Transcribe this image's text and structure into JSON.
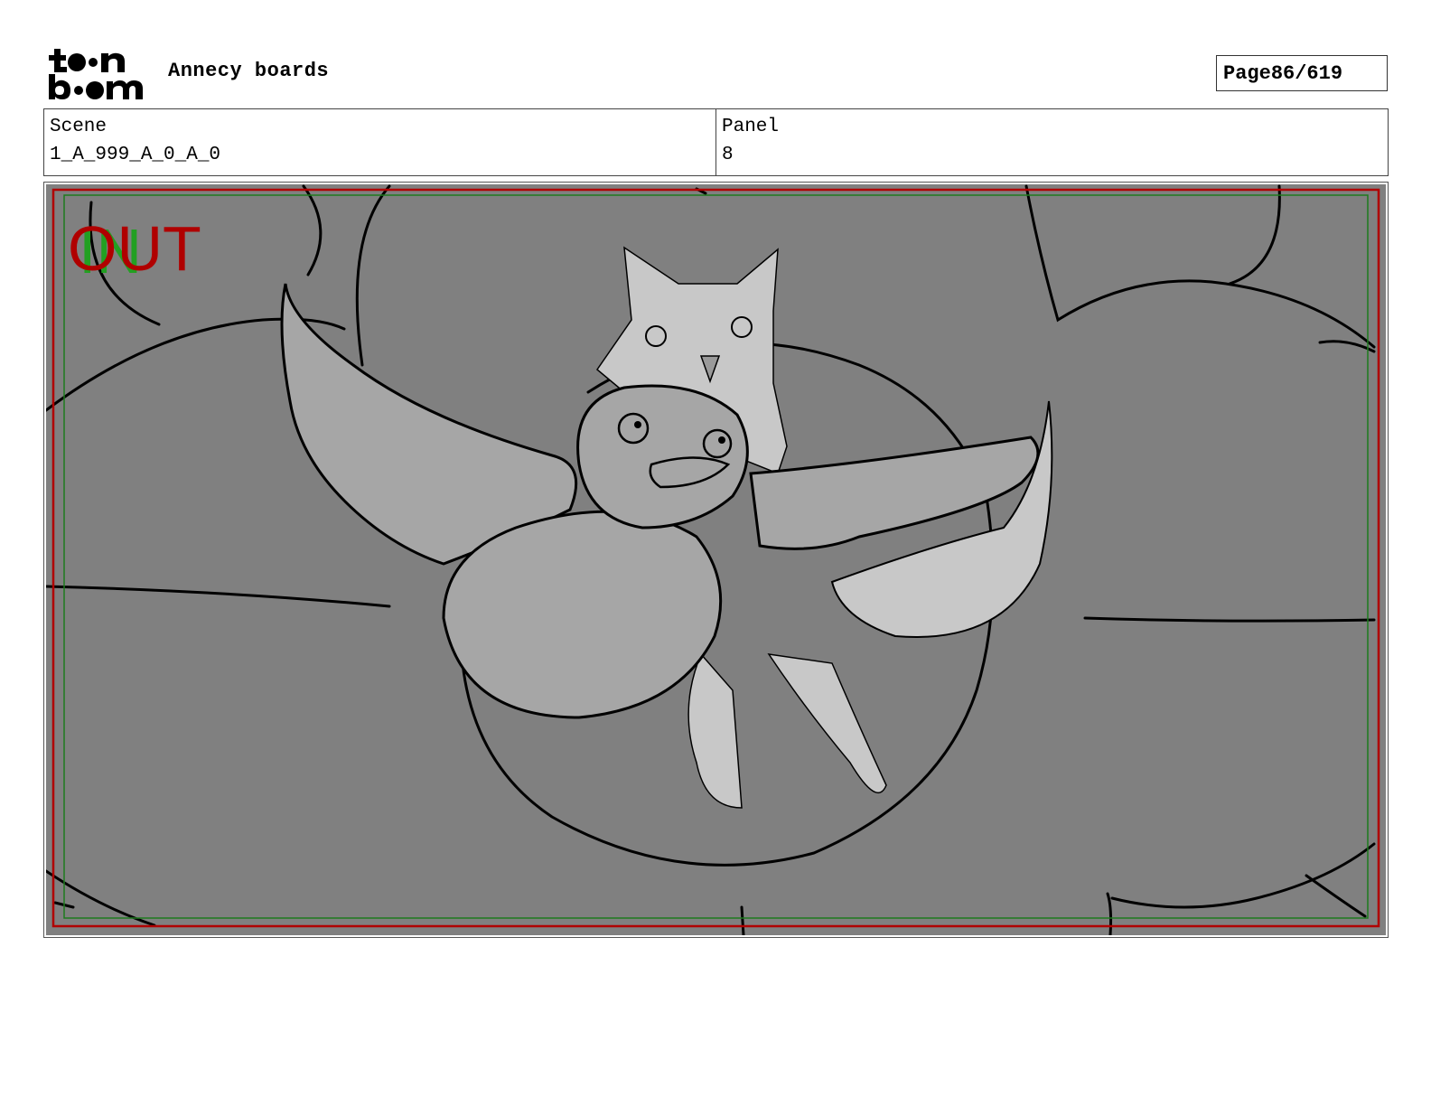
{
  "header": {
    "logo_text_top": "toon",
    "logo_text_bottom": "boom",
    "title": "Annecy boards",
    "page_label": "Page",
    "page_number": "86/619"
  },
  "info": {
    "scene_label": "Scene",
    "scene_value": "1_A_999_A_0_A_0",
    "panel_label": "Panel",
    "panel_value": "8"
  },
  "panel": {
    "out_label": "OUT",
    "in_label": "IN",
    "colors": {
      "background": "#808080",
      "out_frame": "#b00000",
      "in_frame": "#1e7a1e",
      "in_text": "#22a022",
      "character_light": "#c8c8c8",
      "character_mid": "#a6a6a6"
    }
  }
}
